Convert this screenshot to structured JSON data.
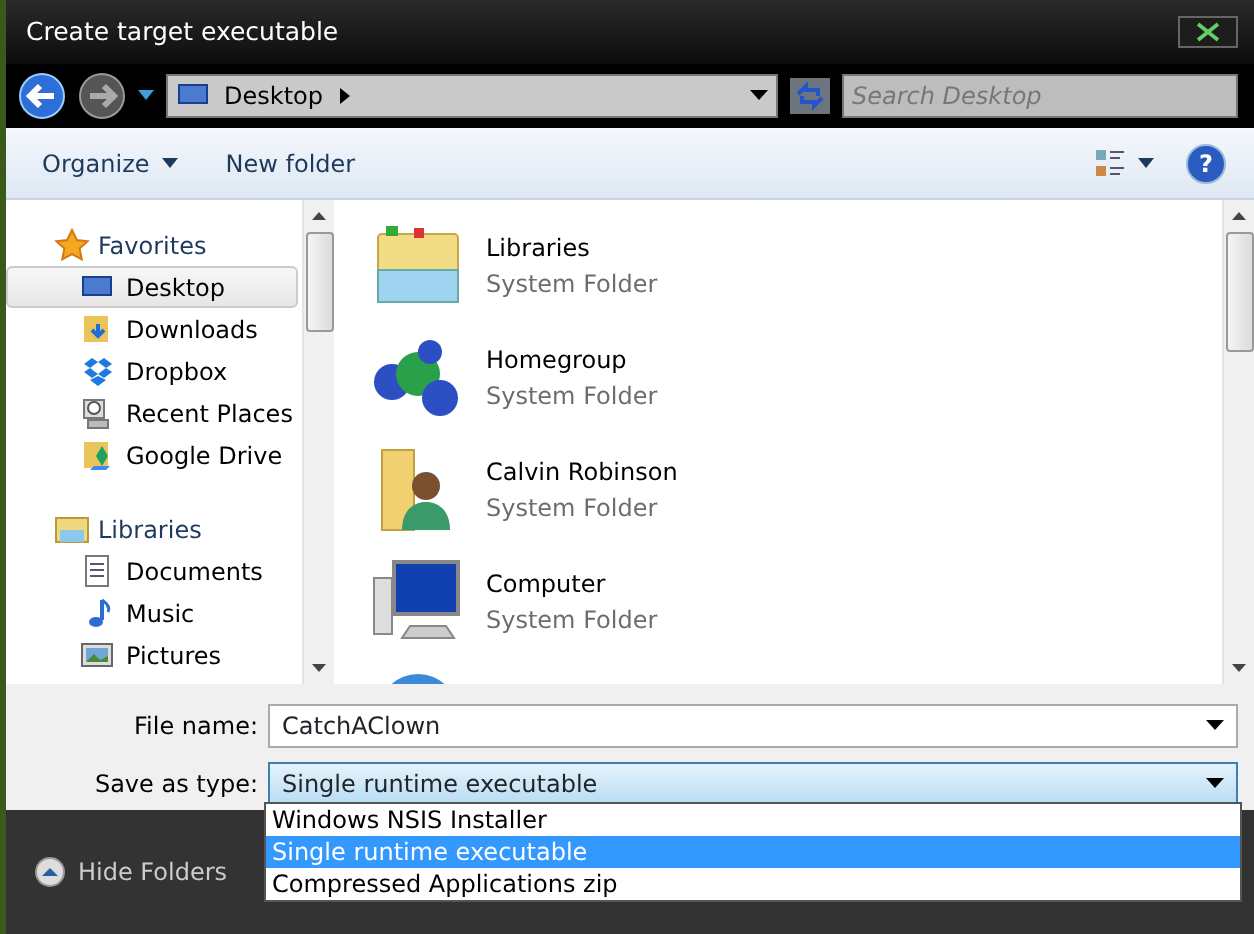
{
  "window": {
    "title": "Create target executable"
  },
  "address_bar": {
    "location": "Desktop"
  },
  "search": {
    "placeholder": "Search Desktop"
  },
  "toolbar": {
    "buttons": [
      {
        "label": "Organize",
        "dropdown": true
      },
      {
        "label": "New folder",
        "dropdown": false
      }
    ],
    "help": "?"
  },
  "sidebar": {
    "groups": [
      {
        "label": "Favorites",
        "kind": "favorites",
        "items": [
          {
            "label": "Desktop",
            "kind": "desktop",
            "selected": true
          },
          {
            "label": "Downloads",
            "kind": "downloads",
            "selected": false
          },
          {
            "label": "Dropbox",
            "kind": "dropbox",
            "selected": false
          },
          {
            "label": "Recent Places",
            "kind": "recent",
            "selected": false
          },
          {
            "label": "Google Drive",
            "kind": "drive",
            "selected": false
          }
        ]
      },
      {
        "label": "Libraries",
        "kind": "libraries",
        "items": [
          {
            "label": "Documents",
            "kind": "documents",
            "selected": false
          },
          {
            "label": "Music",
            "kind": "music",
            "selected": false
          },
          {
            "label": "Pictures",
            "kind": "pictures",
            "selected": false
          }
        ]
      }
    ]
  },
  "files": [
    {
      "name": "Libraries",
      "type": "System Folder",
      "kind": "libraries"
    },
    {
      "name": "Homegroup",
      "type": "System Folder",
      "kind": "homegroup"
    },
    {
      "name": "Calvin Robinson",
      "type": "System Folder",
      "kind": "user"
    },
    {
      "name": "Computer",
      "type": "System Folder",
      "kind": "computer"
    }
  ],
  "form": {
    "file_name_label": "File name:",
    "file_name": "CatchAClown",
    "type_label": "Save as type:",
    "type_value": "Single runtime executable",
    "type_options": [
      {
        "label": "Windows NSIS Installer",
        "selected": false
      },
      {
        "label": "Single runtime executable",
        "selected": true
      },
      {
        "label": "Compressed Applications zip",
        "selected": false
      }
    ]
  },
  "footer": {
    "hide_folders": "Hide Folders"
  }
}
